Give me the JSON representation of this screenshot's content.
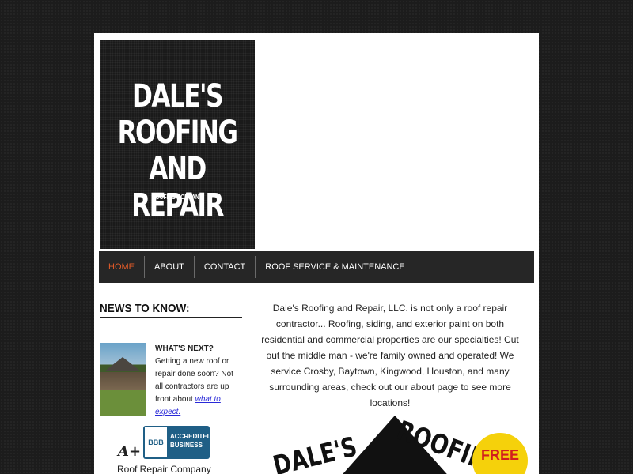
{
  "logo": {
    "lines": [
      "DALE'S",
      "ROOFING",
      "AND REPAIR"
    ],
    "subtitle": "ROOFING COMPANY"
  },
  "nav": {
    "items": [
      {
        "label": "HOME",
        "active": true
      },
      {
        "label": "ABOUT",
        "active": false
      },
      {
        "label": "CONTACT",
        "active": false
      },
      {
        "label": "ROOF SERVICE & MAINTENANCE",
        "active": false
      }
    ],
    "active_color": "#e05a28"
  },
  "sidebar": {
    "news_title": "NEWS TO KNOW:",
    "news_heading": "WHAT'S NEXT?",
    "news_body": "Getting a new roof or repair done soon?  Not all contractors are up front about ",
    "news_link": "what to expect.",
    "bbb_grade": "A+",
    "bbb_logo_text": "BBB",
    "bbb_label_1": "ACCREDITED",
    "bbb_label_2": "BUSINESS",
    "bbb_caption": "Roof Repair Company"
  },
  "main": {
    "paragraph": "Dale's Roofing and Repair, LLC. is not only a roof repair contractor... Roofing, siding, and exterior paint on both residential and commercial properties are our specialties!  Cut out the middle man - we're family owned and operated!  We service Crosby, Baytown, Kingwood, Houston, and many surrounding areas, check out our about page to see more locations!",
    "banner_left": "DALE'S",
    "banner_right": "ROOFING",
    "badge": "FREE"
  }
}
